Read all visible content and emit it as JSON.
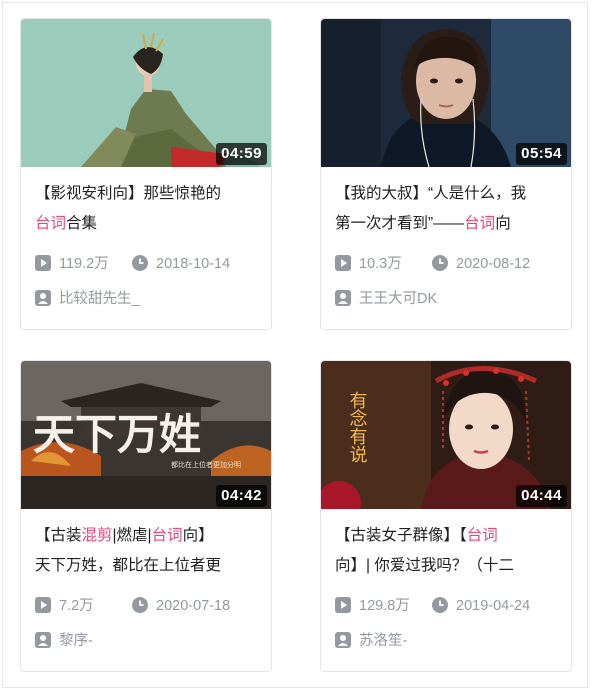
{
  "videos": [
    {
      "duration": "04:59",
      "title_line1": [
        "【影视安利向】那些惊艳的"
      ],
      "title_line2": [
        {
          "t": "台词",
          "hl": true
        },
        {
          "t": "合集",
          "hl": false
        }
      ],
      "views": "119.2万",
      "date": "2018-10-14",
      "author": "比较甜先生_",
      "thumb_icon": "woman-in-robe-thumbnail"
    },
    {
      "duration": "05:54",
      "title_line1": [
        "【我的大叔】“人是什么，我"
      ],
      "title_line2": [
        {
          "t": "第一次才看到”——",
          "hl": false
        },
        {
          "t": "台词",
          "hl": true
        },
        {
          "t": "向",
          "hl": false
        }
      ],
      "views": "10.3万",
      "date": "2020-08-12",
      "author": "王王大可DK",
      "thumb_icon": "girl-with-earphones-thumbnail"
    },
    {
      "duration": "04:42",
      "title_line1": [
        {
          "t": "【古装",
          "hl": false
        },
        {
          "t": "混剪",
          "hl": true
        },
        {
          "t": "|燃虐|",
          "hl": false
        },
        {
          "t": "台词",
          "hl": true
        },
        {
          "t": "向】",
          "hl": false
        }
      ],
      "title_line2": [
        {
          "t": "天下万姓，都比在上位者更",
          "hl": false
        }
      ],
      "views": "7.2万",
      "date": "2020-07-18",
      "author": "黎序-",
      "thumb_icon": "palace-fire-calligraphy-thumbnail",
      "thumb_text": "天下万姓",
      "thumb_subtext": "都比在上位者更加分明"
    },
    {
      "duration": "04:44",
      "title_line1": [
        {
          "t": "【古装女子群像】【",
          "hl": false
        },
        {
          "t": "台词",
          "hl": true
        }
      ],
      "title_line2": [
        {
          "t": "向】| 你爱过我吗？（十二",
          "hl": false
        }
      ],
      "views": "129.8万",
      "date": "2019-04-24",
      "author": "苏洛笙-",
      "thumb_icon": "woman-with-headdress-thumbnail",
      "thumb_text": "有念有说"
    }
  ],
  "icons": {
    "views": "play-count-icon",
    "date": "clock-icon",
    "author": "uploader-icon"
  },
  "colors": {
    "highlight": "#e8457a",
    "meta": "#9499a0",
    "title": "#212121"
  }
}
